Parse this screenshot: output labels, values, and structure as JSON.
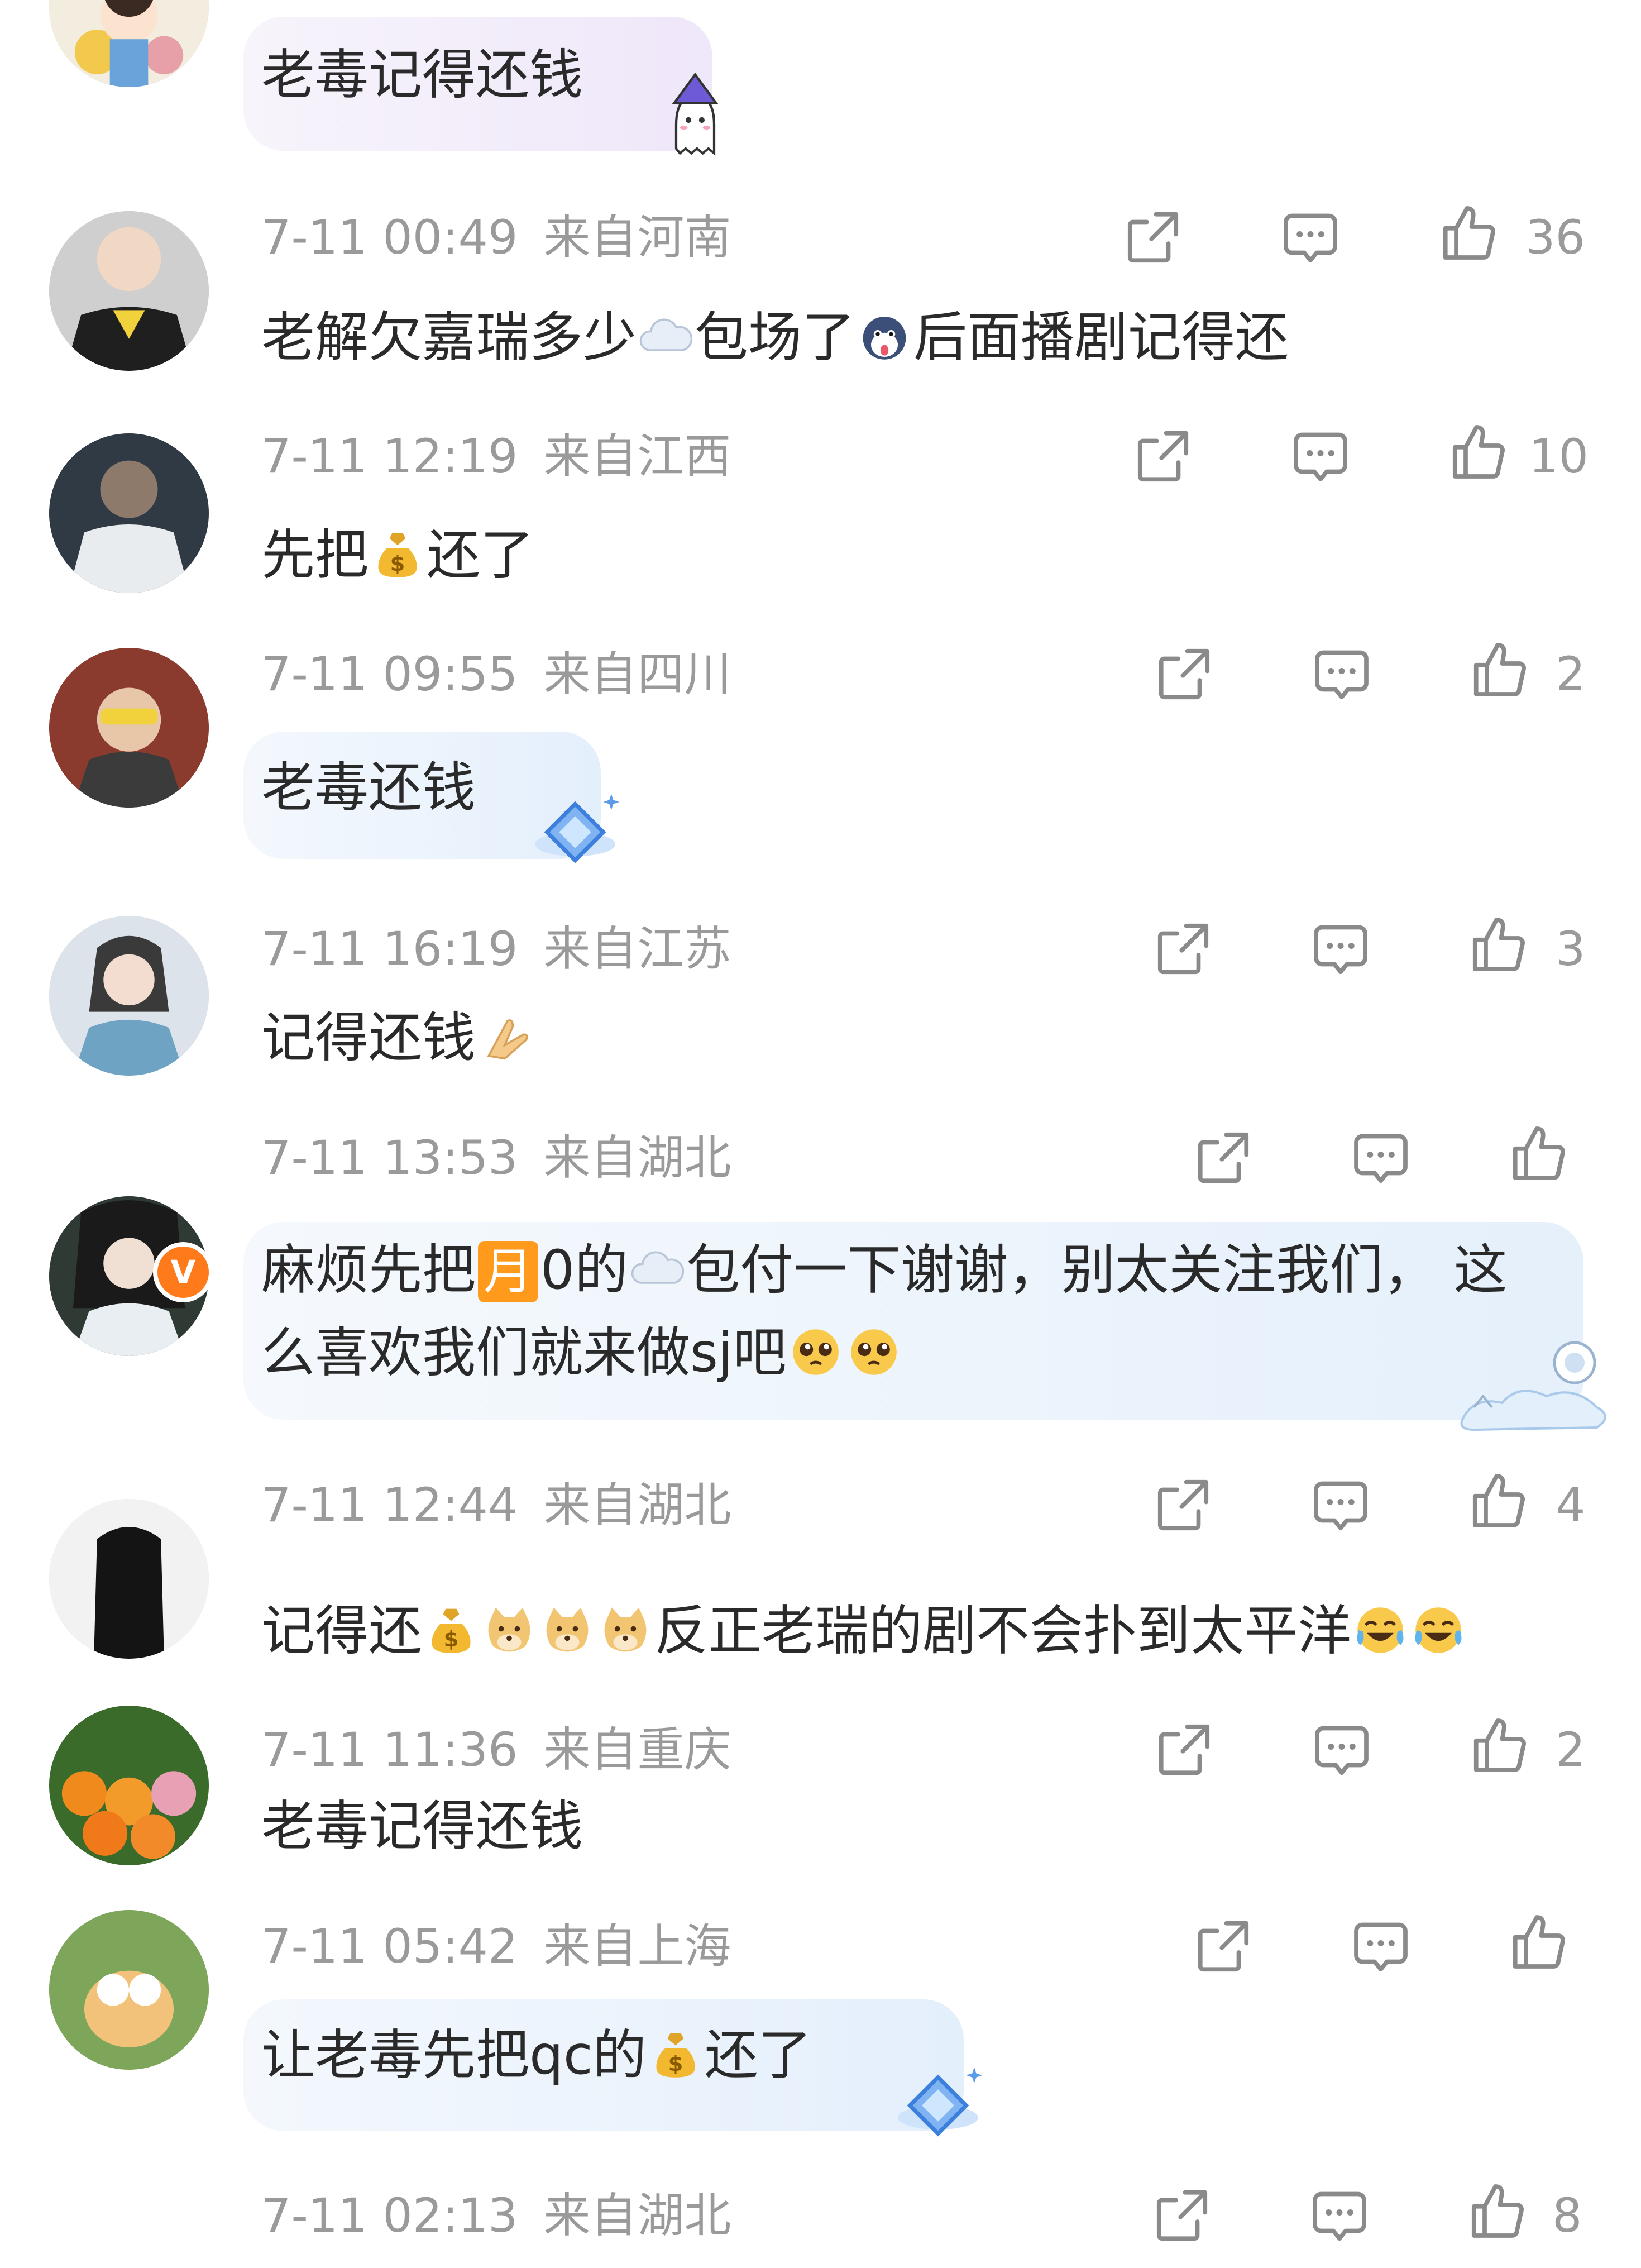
{
  "comments": [
    {
      "text": [
        "老毒记得还钱"
      ],
      "time": "7-11 00:49",
      "location": "来自河南",
      "likes": "36"
    },
    {
      "text": [
        "老解欠嘉瑞多少",
        "包场了",
        "后面播剧记得还"
      ],
      "time": "7-11 12:19",
      "location": "来自江西",
      "likes": "10"
    },
    {
      "text": [
        "先把",
        "还了"
      ],
      "time": "7-11 09:55",
      "location": "来自四川",
      "likes": "2"
    },
    {
      "text": [
        "老毒还钱"
      ],
      "time": "7-11 16:19",
      "location": "来自江苏",
      "likes": "3"
    },
    {
      "text": [
        "记得还钱"
      ],
      "time": "7-11 13:53",
      "location": "来自湖北",
      "likes": ""
    },
    {
      "text": [
        "麻烦先把",
        "月",
        "0的",
        "包付一下谢谢，别太关注我们， 这",
        "么喜欢我们就来做sj吧"
      ],
      "time": "7-11 12:44",
      "location": "来自湖北",
      "likes": "4",
      "verified_badge": "V"
    },
    {
      "text": [
        "记得还",
        "反正老瑞的剧不会扑到太平洋"
      ],
      "time": "7-11 11:36",
      "location": "来自重庆",
      "likes": "2"
    },
    {
      "text": [
        "老毒记得还钱"
      ],
      "time": "7-11 05:42",
      "location": "来自上海",
      "likes": ""
    },
    {
      "text": [
        "让老毒先把qc的",
        "还了"
      ],
      "time": "7-11 02:13",
      "location": "来自湖北",
      "likes": "8"
    }
  ],
  "icons": {
    "share": "share-icon",
    "comment": "comment-icon",
    "like": "thumbs-up-icon",
    "cloud": "cloud-emoji",
    "money_bag": "money-bag-emoji",
    "dog": "doge-emoji",
    "laugh": "laughing-crying-emoji",
    "pleading": "pleading-face-emoji",
    "pray": "folded-hands-emoji",
    "husky": "husky-emoji"
  },
  "colors": {
    "text": "#2a2a2a",
    "meta": "#9a9a9a",
    "icon": "#8a8a8a",
    "bubble_purple": "#f1ecfb",
    "bubble_blue": "#e6f1fd",
    "badge": "#ff7a1a"
  }
}
